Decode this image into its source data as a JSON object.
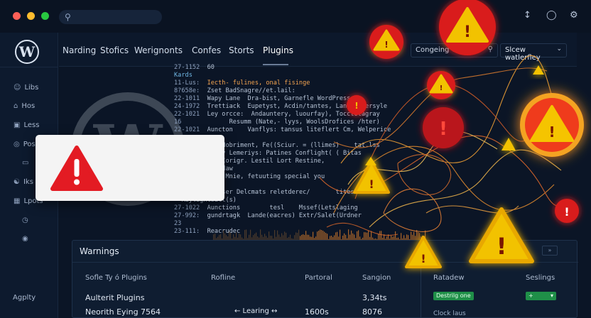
{
  "window": {
    "traffic_lights": [
      "#ff5f57",
      "#febc2e",
      "#28c840"
    ],
    "search_icon": "search-icon",
    "toolbar_icons": [
      "pin-icon",
      "chat-icon",
      "gear-icon"
    ]
  },
  "sidebar": {
    "items": [
      {
        "label": "Libs",
        "icon": "user-icon"
      },
      {
        "label": "Hos",
        "icon": "house-icon"
      },
      {
        "label": "Less",
        "icon": "window-icon"
      },
      {
        "label": "Pos",
        "icon": "pin-icon"
      },
      {
        "label": "",
        "icon": "lock-icon"
      },
      {
        "label": "Iks",
        "icon": "people-icon"
      },
      {
        "label": "Lpots",
        "icon": "grid-icon"
      },
      {
        "label": "",
        "icon": "clock-icon"
      },
      {
        "label": "",
        "icon": "shield-icon"
      }
    ],
    "footer": "Agplty"
  },
  "nav": {
    "items": [
      "Narding",
      "Stofics",
      "Werignonts",
      "Confes",
      "Storts",
      "Plugins"
    ],
    "active": "Plugins",
    "input_value": "Congeing O",
    "select_value": "Slcew watlerfley"
  },
  "code": {
    "lines": [
      {
        "ln": "27-1152",
        "text": "60",
        "style": "plain"
      },
      {
        "ln": "Kards",
        "text": "",
        "style": "cyan"
      },
      {
        "ln": "11-Lus:",
        "text": "Iecth- fulines, onal fisinge",
        "style": "orange"
      },
      {
        "ln": "8?658e:",
        "text": "Zset BadSnagre//et.lail:",
        "style": "plain"
      },
      {
        "ln": "22-1011",
        "text": "Wapy Lane  Dra-bist, Garnefle WordPress",
        "style": "plain"
      },
      {
        "ln": "24-1972",
        "text": "Trettiack  Eupetyst, Acdin/tantes, Langme  ersyle",
        "style": "plain"
      },
      {
        "ln": "22-1021",
        "text": "Ley orcce:  Andauntery, luourfay), Tocctotagray",
        "style": "plain"
      },
      {
        "ln": "16",
        "text": "           Resumm (Nate,- lyys, WoolsDrofices /hter)",
        "style": "plain"
      },
      {
        "ln": "22-1021",
        "text": "Auncton    Vanflys: tansus liteflert Cm, Welperice",
        "style": "plain"
      },
      {
        "ln": "",
        "text": "",
        "style": "plain"
      },
      {
        "ln": "Dsrcelen:",
        "text": "I Nobriment, Fe((Sciur. = (llimes)    tat.lss",
        "style": "plain"
      },
      {
        "ln": "Canfins",
        "text": "Letey Lemeriys: Patines Conflight( ( Bitas",
        "style": "plain"
      },
      {
        "ln": "Sanfto",
        "text": "Stal Corigr. Lestil Lort Restine,",
        "style": "plain"
      },
      {
        "ln": "",
        "text": "          idaw",
        "style": "plain"
      },
      {
        "ln": "Sorfteo:",
        "text": "Reb Mnie, fetuuting special you",
        "style": "plain"
      },
      {
        "ln": "",
        "text": "",
        "style": "plain"
      },
      {
        "ln": "Sturilo:",
        "text": "(urser Delcmats reletderec/       titesl ad",
        "style": "plain"
      },
      {
        "ln": "",
        "text": "Raylightsall(s)",
        "style": "plain"
      },
      {
        "ln": "27-1022",
        "text": "Aunctions        tesl    Mssef(Letslaging",
        "style": "plain"
      },
      {
        "ln": "27-992:",
        "text": "gundrtagk  Lande(eacres) Extr/Salet(Urdner",
        "style": "plain"
      },
      {
        "ln": "23",
        "text": "",
        "style": "plain"
      },
      {
        "ln": "23-111:",
        "text": "Reacrudec",
        "style": "plain"
      }
    ]
  },
  "error_card": {
    "icon": "warning-icon",
    "color": "#e31b23"
  },
  "warnings_panel": {
    "title": "Warnings",
    "expand_label": "»",
    "headers": [
      "Sofle Ty ó Plugins",
      "Rofline",
      "Partoral",
      "Sangion",
      "Ratadew",
      "Seslings"
    ],
    "rows": [
      {
        "name": "Aulterit Plugins",
        "rofline": "",
        "partoral": "",
        "sangion": "3,34ts",
        "ratadew": "Destrilg one",
        "seslings": "+"
      },
      {
        "name": "Neorith Eying 7564",
        "rofline": "← Learing ↔",
        "partoral": "1600s",
        "sangion": "8076",
        "ratadew": "Clock laus",
        "seslings": ""
      }
    ]
  },
  "colors": {
    "background": "#0b1526",
    "warning_yellow": "#f2c200",
    "warning_red": "#e31b23",
    "accent_green": "#1f8f48"
  }
}
